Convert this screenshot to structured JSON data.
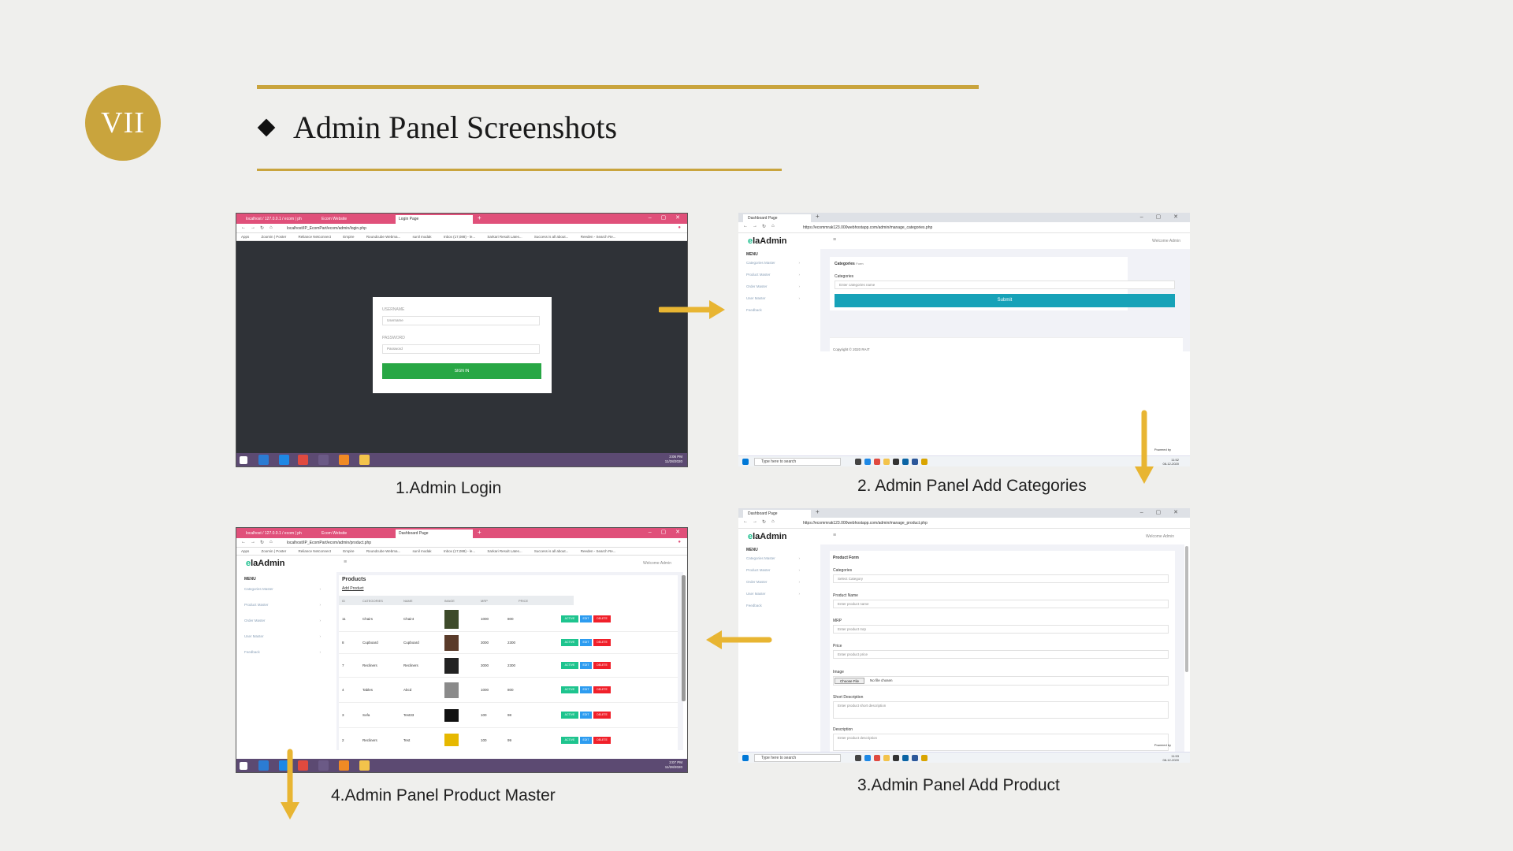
{
  "slide": {
    "number": "VII",
    "title": "Admin Panel Screenshots",
    "accent_color": "#c9a43d"
  },
  "captions": {
    "login": "1.Admin Login",
    "categories": "2. Admin Panel Add Categories",
    "product": "3.Admin Panel Add Product",
    "product_master": "4.Admin Panel Product Master"
  },
  "login_shot": {
    "tabs": [
      "localhost / 127.0.0.1 / ecom | ph",
      "Ecom Website",
      "Login Page"
    ],
    "url": "localhost/IP_EcomPart/ecom/admin/login.php",
    "bookmarks": [
      "Apps",
      "Zoomin | Poster",
      "Reliance Netconnect",
      "Empire",
      "Roundcube Webma...",
      "sunil modak",
      "Inbox (17,088) - le...",
      "Sarkari Result Lates...",
      "Success is all about...",
      "Reeden - Search Re..."
    ],
    "username_label": "USERNAME",
    "username_placeholder": "Username",
    "password_label": "PASSWORD",
    "password_placeholder": "Password",
    "signin_label": "SIGN IN",
    "clock_time": "3:06 PM",
    "clock_date": "11/28/2020"
  },
  "categories_shot": {
    "tab": "Dashboard Page",
    "url": "https://ecommrak123.000webhostapp.com/admin/manage_categories.php",
    "brand_e": "e",
    "brand_rest": "laAdmin",
    "welcome": "Welcome Admin",
    "menu_heading": "MENU",
    "menu_items": [
      "Categories Master",
      "Product Master",
      "Order Master",
      "User Master",
      "Feedback"
    ],
    "form_title": "Categories",
    "form_title_suffix": "Form",
    "field_label": "Categories",
    "field_placeholder": "Enter categories name",
    "submit_label": "Submit",
    "copyright": "Copyright © 2020 RAIT",
    "powered": "Powered by",
    "search_placeholder": "Type here to search",
    "clock_time": "11:52",
    "clock_date": "08-12-2020"
  },
  "product_shot": {
    "tab": "Dashboard Page",
    "url": "https://ecommrak123.000webhostapp.com/admin/manage_product.php",
    "brand_e": "e",
    "brand_rest": "laAdmin",
    "welcome": "Welcome Admin",
    "menu_heading": "MENU",
    "menu_items": [
      "Categories Master",
      "Product Master",
      "Order Master",
      "User Master",
      "Feedback"
    ],
    "form_title": "Product Form",
    "fields": [
      {
        "label": "Categories",
        "placeholder": "Select Category"
      },
      {
        "label": "Product Name",
        "placeholder": "Enter product name"
      },
      {
        "label": "MRP",
        "placeholder": "Enter product mrp"
      },
      {
        "label": "Price",
        "placeholder": "Enter product price"
      },
      {
        "label": "Image",
        "placeholder": "No file chosen"
      },
      {
        "label": "Short Description",
        "placeholder": "Enter product short description"
      },
      {
        "label": "Description",
        "placeholder": "Enter product description"
      }
    ],
    "choose_file": "Choose File",
    "powered": "Powered by",
    "search_placeholder": "Type here to search",
    "clock_time": "11:53",
    "clock_date": "08-12-2020"
  },
  "master_shot": {
    "tabs": [
      "localhost / 127.0.0.1 / ecom | ph",
      "Ecom Website",
      "Dashboard Page"
    ],
    "url": "localhost/IP_EcomPart/ecom/admin/product.php",
    "brand_e": "e",
    "brand_rest": "laAdmin",
    "welcome": "Welcome Admin",
    "menu_heading": "MENU",
    "menu_items": [
      "Categories Master",
      "Product Master",
      "Order Master",
      "User Master",
      "Feedback"
    ],
    "page_title": "Products",
    "add_link": "Add Product",
    "columns": [
      "ID",
      "CATEGORIES",
      "NAME",
      "IMAGE",
      "MRP",
      "PRICE"
    ],
    "rows": [
      {
        "id": "11",
        "category": "Chairs",
        "name": "Chair4",
        "mrp": "1000",
        "price": "800"
      },
      {
        "id": "8",
        "category": "Cupboard",
        "name": "Cupboard",
        "mrp": "3000",
        "price": "2300"
      },
      {
        "id": "7",
        "category": "Recliners",
        "name": "Recliners",
        "mrp": "3000",
        "price": "2300"
      },
      {
        "id": "4",
        "category": "Tables",
        "name": "Abcd",
        "mrp": "1000",
        "price": "800"
      },
      {
        "id": "3",
        "category": "Sofa",
        "name": "Test33",
        "mrp": "100",
        "price": "98"
      },
      {
        "id": "2",
        "category": "Recliners",
        "name": "Test",
        "mrp": "100",
        "price": "99"
      }
    ],
    "btn_active": "ACTIVE",
    "btn_edit": "EDIT",
    "btn_delete": "DELETE",
    "clock_time": "3:07 PM",
    "clock_date": "11/28/2020"
  }
}
